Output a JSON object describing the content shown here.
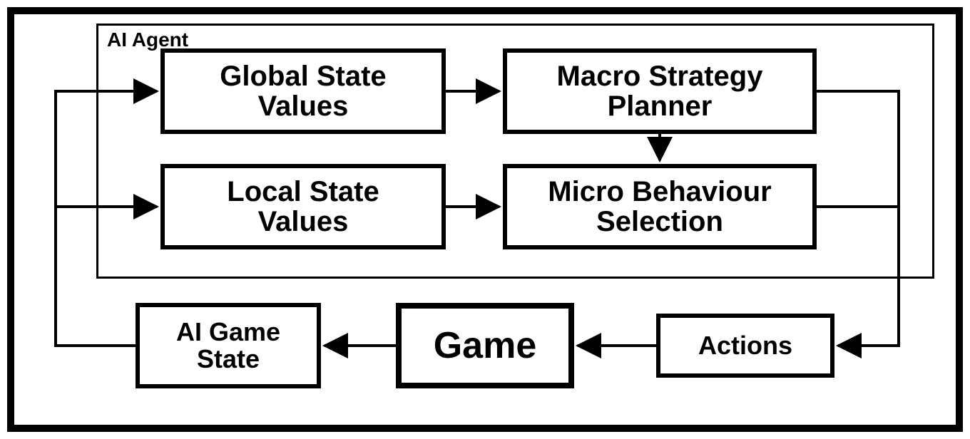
{
  "agent_label": "AI Agent",
  "nodes": {
    "global_state": "Global State\nValues",
    "local_state": "Local State\nValues",
    "macro_planner": "Macro Strategy\nPlanner",
    "micro_selection": "Micro Behaviour\nSelection",
    "ai_game_state": "AI Game\nState",
    "game": "Game",
    "actions": "Actions"
  },
  "edges": [
    {
      "from": "global_state",
      "to": "macro_planner"
    },
    {
      "from": "local_state",
      "to": "micro_selection"
    },
    {
      "from": "macro_planner",
      "to": "actions"
    },
    {
      "from": "micro_selection",
      "to": "actions"
    },
    {
      "from": "actions",
      "to": "game"
    },
    {
      "from": "game",
      "to": "ai_game_state"
    },
    {
      "from": "ai_game_state",
      "to": "global_state"
    },
    {
      "from": "ai_game_state",
      "to": "local_state"
    },
    {
      "from": "macro_planner",
      "to": "micro_selection"
    }
  ]
}
